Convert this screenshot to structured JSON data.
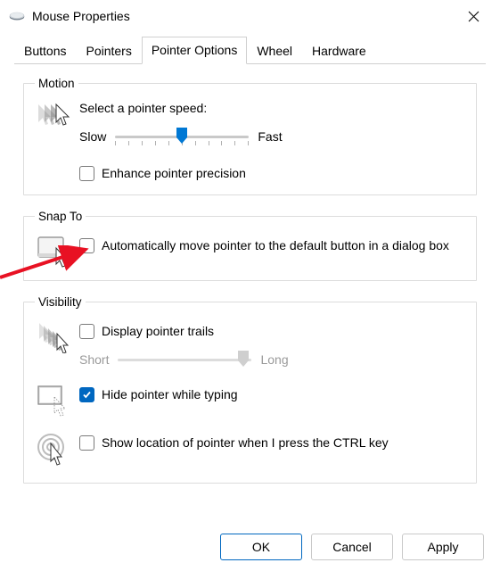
{
  "window": {
    "title": "Mouse Properties"
  },
  "tabs": {
    "buttons": "Buttons",
    "pointers": "Pointers",
    "pointer_options": "Pointer Options",
    "wheel": "Wheel",
    "hardware": "Hardware",
    "active": "pointer_options"
  },
  "motion": {
    "legend": "Motion",
    "select_speed": "Select a pointer speed:",
    "slow": "Slow",
    "fast": "Fast",
    "speed_value": 6,
    "speed_min": 1,
    "speed_max": 11,
    "enhance_precision": {
      "label": "Enhance pointer precision",
      "checked": false
    }
  },
  "snap_to": {
    "legend": "Snap To",
    "auto_move": {
      "label": "Automatically move pointer to the default button in a dialog box",
      "checked": false
    }
  },
  "visibility": {
    "legend": "Visibility",
    "trails": {
      "label": "Display pointer trails",
      "checked": false,
      "short": "Short",
      "long": "Long"
    },
    "hide_typing": {
      "label": "Hide pointer while typing",
      "checked": true
    },
    "show_ctrl": {
      "label": "Show location of pointer when I press the CTRL key",
      "checked": false
    }
  },
  "buttons": {
    "ok": "OK",
    "cancel": "Cancel",
    "apply": "Apply"
  }
}
